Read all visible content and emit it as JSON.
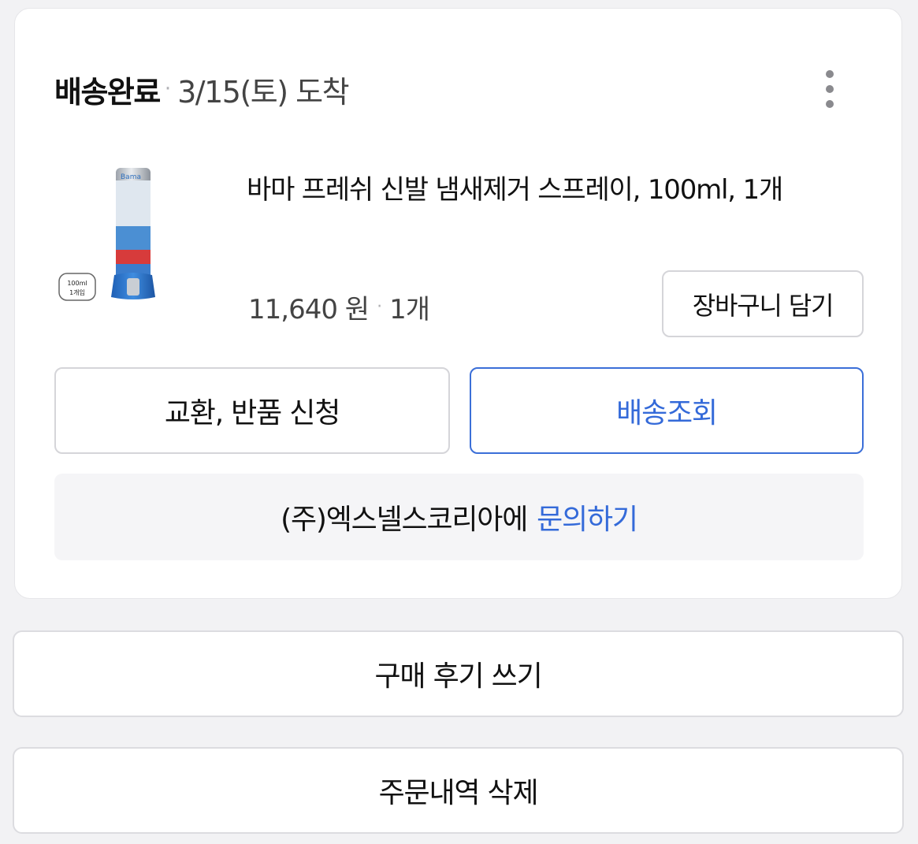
{
  "order": {
    "status": "배송완료",
    "separator": "·",
    "arrival": "3/15(토) 도착",
    "more_icon": "more-vertical-icon"
  },
  "product": {
    "name": "바마 프레쉬 신발 냄새제거 스프레이, 100ml, 1개",
    "price": "11,640 원",
    "quantity": "1개",
    "thumbnail_brand": "Bama",
    "thumbnail_tag_top": "100ml",
    "thumbnail_tag_bottom": "1개입"
  },
  "actions": {
    "add_to_cart": "장바구니 담기",
    "exchange_return": "교환, 반품 신청",
    "track_delivery": "배송조회"
  },
  "inquiry": {
    "seller_text": "(주)엑스넬스코리아에",
    "link_text": "문의하기"
  },
  "footer": {
    "write_review": "구매 후기 쓰기",
    "delete_order": "주문내역 삭제"
  },
  "colors": {
    "accent": "#346ad9",
    "background": "#f2f2f4",
    "card": "#ffffff"
  }
}
